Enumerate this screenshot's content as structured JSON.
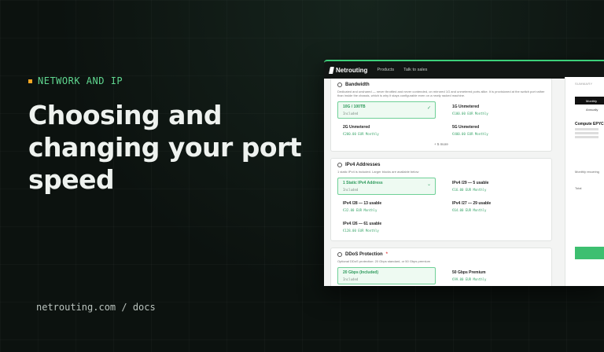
{
  "hero": {
    "eyebrow": "NETWORK AND IP",
    "headline_1": "Choosing and",
    "headline_2": "changing your port",
    "headline_3": "speed",
    "footer_url": "netrouting.com / docs"
  },
  "colors": {
    "accent": "#3dd07a",
    "eyebrow": "#5fd68f",
    "dot": "#f5a623",
    "background": "#0c120f"
  },
  "app": {
    "brand": "Netrouting",
    "nav": [
      "Products",
      "Talk to sales"
    ],
    "bandwidth": {
      "title": "Bandwidth",
      "desc": "Dedicated and unshared — never throttled and never contended, on mirrored 1G and unmetered ports alike. It is provisioned at the switch port rather than inside the chassis, which is why it stays configurable even on a newly racked machine.",
      "options": [
        {
          "name": "10G / 100TB",
          "price": "Included",
          "selected": true
        },
        {
          "name": "1G Unmetered",
          "price": "€100.00 EUR Monthly"
        },
        {
          "name": "2G Unmetered",
          "price": "€200.00 EUR Monthly"
        },
        {
          "name": "5G Unmetered",
          "price": "€400.00 EUR Monthly"
        }
      ],
      "more": "+ 5 more"
    },
    "ipv4": {
      "title": "IPv4 Addresses",
      "desc": "1 static IPv4 is included. Larger blocks are available below",
      "options": [
        {
          "name": "1 Static IPv4 Address",
          "price": "Included",
          "selected": true
        },
        {
          "name": "IPv4 /29 — 5 usable",
          "price": "€16.00 EUR Monthly"
        },
        {
          "name": "IPv4 /28 — 13 usable",
          "price": "€32.00 EUR Monthly"
        },
        {
          "name": "IPv4 /27 — 29 usable",
          "price": "€64.00 EUR Monthly"
        },
        {
          "name": "IPv4 /26 — 61 usable",
          "price": "€128.00 EUR Monthly"
        }
      ]
    },
    "ddos": {
      "title": "DDoS Protection",
      "required": "*",
      "desc": "Optional DDoS protection: 20 Gbps standard, or 50 Gbps premium",
      "options": [
        {
          "name": "20 Gbps (Included)",
          "price": "Included",
          "selected": true
        },
        {
          "name": "50 Gbps Premium",
          "price": "€99.00 EUR Monthly"
        }
      ]
    },
    "sidebar": {
      "summary": "SUMMARY",
      "billing": "Monthly",
      "billing_alt": "Annually",
      "product": "Compute EPYC",
      "recurring": "Monthly recurring",
      "total": "Total"
    }
  }
}
